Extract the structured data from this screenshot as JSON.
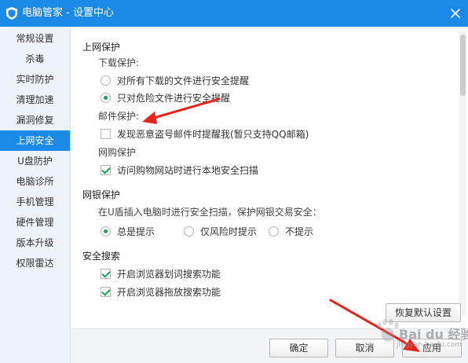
{
  "window": {
    "title": "电脑管家 - 设置中心"
  },
  "sidebar": {
    "items": [
      {
        "label": "常规设置",
        "active": false
      },
      {
        "label": "杀毒",
        "active": false
      },
      {
        "label": "实时防护",
        "active": false
      },
      {
        "label": "清理加速",
        "active": false
      },
      {
        "label": "漏洞修复",
        "active": false
      },
      {
        "label": "上网安全",
        "active": true
      },
      {
        "label": "U盘防护",
        "active": false
      },
      {
        "label": "电脑诊所",
        "active": false
      },
      {
        "label": "手机管理",
        "active": false
      },
      {
        "label": "硬件管理",
        "active": false
      },
      {
        "label": "版本升级",
        "active": false
      },
      {
        "label": "权限雷达",
        "active": false
      }
    ]
  },
  "sections": {
    "web": {
      "title": "上网保护",
      "download": {
        "title": "下载保护:",
        "options": [
          {
            "label": "对所有下载的文件进行安全提醒",
            "checked": false
          },
          {
            "label": "只对危险文件进行安全提醒",
            "checked": true
          }
        ]
      },
      "mail": {
        "title": "邮件保护:",
        "option": {
          "label": "发现恶意盗号邮件时提醒我(暂只支持QQ邮箱)",
          "checked": false
        }
      },
      "shopping": {
        "title": "网购保护",
        "option": {
          "label": "访问购物网站时进行本地安全扫描",
          "checked": true
        }
      }
    },
    "bank": {
      "title": "网银保护",
      "desc": "在U盾插入电脑时进行安全扫描，保护网银交易安全：",
      "options": [
        {
          "label": "总是提示",
          "checked": true
        },
        {
          "label": "仅风险时提示",
          "checked": false
        },
        {
          "label": "不提示",
          "checked": false
        }
      ]
    },
    "search": {
      "title": "安全搜索",
      "options": [
        {
          "label": "开启浏览器划词搜索功能",
          "checked": true
        },
        {
          "label": "开启浏览器拖放搜索功能",
          "checked": true
        }
      ]
    }
  },
  "buttons": {
    "restore": "恢复默认设置",
    "ok": "确定",
    "cancel": "取消",
    "apply": "应用"
  },
  "watermark": {
    "text": "Bai du 经验",
    "sub": "jingyan.baidu.com"
  },
  "colors": {
    "accent": "#1a8ae6",
    "check": "#17a35a",
    "arrow": "#e8231c"
  },
  "icons": {
    "logo": "shield-logo-icon",
    "close": "close-icon"
  }
}
